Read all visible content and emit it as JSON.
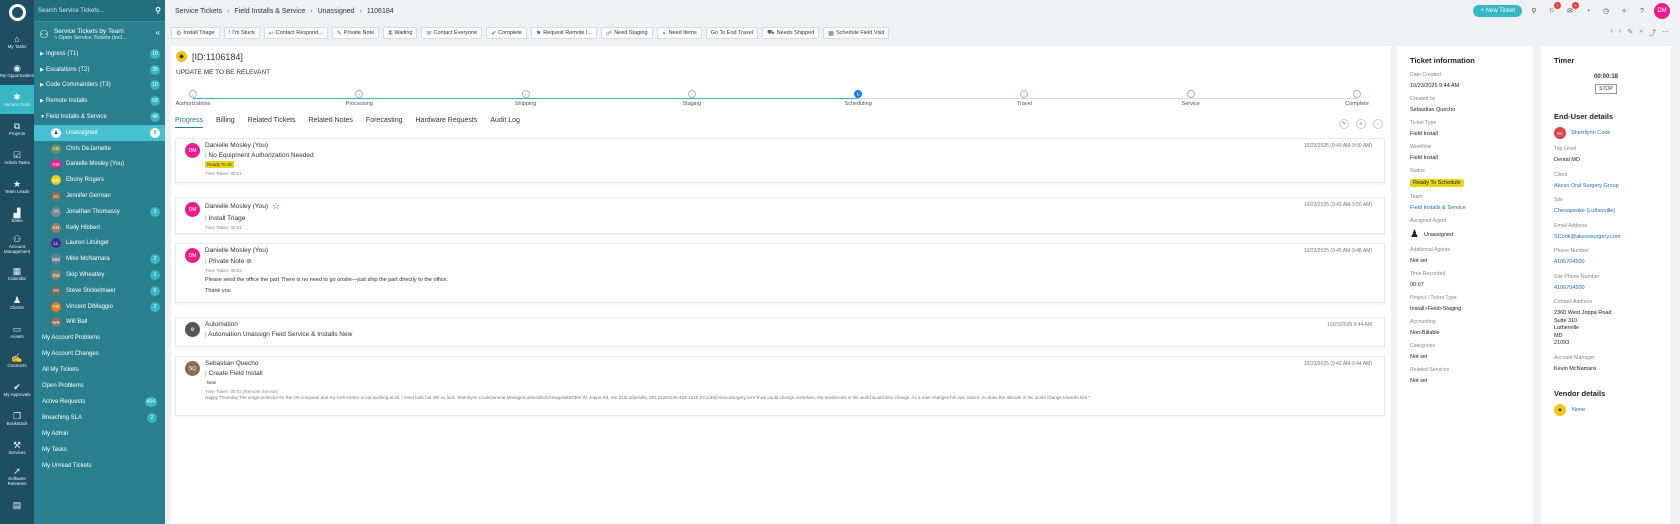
{
  "rail": [
    {
      "label": "My Tasks",
      "icon": "house-icon",
      "glyph": "⌂",
      "active": false
    },
    {
      "label": "My Opportunities",
      "icon": "eye-icon",
      "glyph": "◉",
      "active": false
    },
    {
      "label": "Service Desk",
      "icon": "ticket-icon",
      "glyph": "✱",
      "active": true
    },
    {
      "label": "Projects",
      "icon": "projects-icon",
      "glyph": "⧉",
      "active": false
    },
    {
      "label": "Admin Tasks",
      "icon": "checklist-icon",
      "glyph": "☑",
      "active": false
    },
    {
      "label": "Team Leads",
      "icon": "star-icon",
      "glyph": "★",
      "active": false
    },
    {
      "label": "Sales",
      "icon": "bar-chart-icon",
      "glyph": "▟",
      "active": false
    },
    {
      "label": "Account Management",
      "icon": "people-icon",
      "glyph": "⚇",
      "active": false
    },
    {
      "label": "Calendar",
      "icon": "calendar-icon",
      "glyph": "▦",
      "active": false
    },
    {
      "label": "Clients",
      "icon": "person-icon",
      "glyph": "♟",
      "active": false
    },
    {
      "label": "Assets",
      "icon": "monitor-icon",
      "glyph": "▭",
      "active": false
    },
    {
      "label": "Contracts",
      "icon": "handshake-icon",
      "glyph": "✍",
      "active": false
    },
    {
      "label": "My Approvals",
      "icon": "thumbs-up-icon",
      "glyph": "✔",
      "active": false
    },
    {
      "label": "Bookstack",
      "icon": "book-icon",
      "glyph": "❐",
      "active": false
    },
    {
      "label": "Services",
      "icon": "services-icon",
      "glyph": "⚒",
      "active": false
    },
    {
      "label": "Software Releases",
      "icon": "rocket-icon",
      "glyph": "➚",
      "active": false
    },
    {
      "label": "",
      "icon": "document-icon",
      "glyph": "▤",
      "active": false
    }
  ],
  "sidebar": {
    "search_placeholder": "Search Service Tickets...",
    "header_title": "Service Tickets by Team",
    "header_sub": "Open Service Tickets (incl...",
    "sections": [
      {
        "label": "Ingress (T1)",
        "count": "10",
        "open": false
      },
      {
        "label": "Escalations (T2)",
        "count": "39",
        "open": false
      },
      {
        "label": "Code Commanders (T3)",
        "count": "10",
        "open": false
      },
      {
        "label": "Remote Installs",
        "count": "68",
        "open": false
      },
      {
        "label": "Field Installs & Service",
        "count": "48",
        "open": true
      }
    ],
    "members": [
      {
        "name": "Unassigned",
        "count": "8",
        "initials": "",
        "color": "#ffffff",
        "selected": true
      },
      {
        "name": "Chris DeJarnette",
        "count": "",
        "initials": "CD",
        "color": "#6d8f5a",
        "selected": false
      },
      {
        "name": "Danielle Mosley (You)",
        "count": "",
        "initials": "DM",
        "color": "#e91e8c",
        "selected": false
      },
      {
        "name": "Ebony Rogers",
        "count": "",
        "initials": "ER",
        "color": "#e6d21a",
        "selected": false
      },
      {
        "name": "Jennifer German",
        "count": "",
        "initials": "JG",
        "color": "#8a6d4e",
        "selected": false
      },
      {
        "name": "Jonathan Thomassy",
        "count": "3",
        "initials": "JT",
        "color": "#7a8a9a",
        "selected": false
      },
      {
        "name": "Kelly Hibbert",
        "count": "",
        "initials": "KH",
        "color": "#9c7d6a",
        "selected": false
      },
      {
        "name": "Lauren Litsinger",
        "count": "",
        "initials": "LL",
        "color": "#3f2f8c",
        "selected": false
      },
      {
        "name": "Mike McNamara",
        "count": "2",
        "initials": "MM",
        "color": "#6b7f8f",
        "selected": false
      },
      {
        "name": "Skip Wheatley",
        "count": "1",
        "initials": "SW",
        "color": "#8a7a6a",
        "selected": false
      },
      {
        "name": "Steve Stickelmaier",
        "count": "6",
        "initials": "SS",
        "color": "#7a6a5a",
        "selected": false
      },
      {
        "name": "Vincent DiMaggio",
        "count": "2",
        "initials": "VD",
        "color": "#e57c1a",
        "selected": false
      },
      {
        "name": "Will Ball",
        "count": "",
        "initials": "WB",
        "color": "#8a7060",
        "selected": false
      }
    ],
    "links": [
      {
        "label": "My Account Problems",
        "count": ""
      },
      {
        "label": "My Account Changes",
        "count": ""
      },
      {
        "label": "All My Tickets",
        "count": ""
      },
      {
        "label": "Open Problems",
        "count": ""
      },
      {
        "label": "Active Requests",
        "count": "404"
      },
      {
        "label": "Breaching SLA",
        "count": "2"
      },
      {
        "label": "My Admin",
        "count": ""
      },
      {
        "label": "My Tasks",
        "count": ""
      },
      {
        "label": "My Unread Tickets",
        "count": ""
      }
    ]
  },
  "breadcrumb": [
    "Service Tickets",
    "Field Installs & Service",
    "Unassigned",
    "1106184"
  ],
  "topbar": {
    "new_ticket": "+ New Ticket",
    "user_initials": "DM",
    "badge_a": "2",
    "badge_b": "9"
  },
  "actions": [
    {
      "label": "Install Triage",
      "glyph": "⚙"
    },
    {
      "label": "I'm Stuck",
      "glyph": "!"
    },
    {
      "label": "Contact Respond...",
      "glyph": "↩"
    },
    {
      "label": "Private Note",
      "glyph": "✎"
    },
    {
      "label": "Waiting",
      "glyph": "⧗"
    },
    {
      "label": "Contact Everyone",
      "glyph": "✉"
    },
    {
      "label": "Complete",
      "glyph": "✔"
    },
    {
      "label": "Request Remote I...",
      "glyph": "⚑"
    },
    {
      "label": "Need Staging",
      "glyph": "☍"
    },
    {
      "label": "Need Items",
      "glyph": "⚬"
    },
    {
      "label": "Go To End Travel",
      "glyph": ""
    },
    {
      "label": "Needs Shipped",
      "glyph": "⛟"
    },
    {
      "label": "Schedule Field Visit",
      "glyph": "▦"
    }
  ],
  "ticket": {
    "id": "[ID:1106184]",
    "subject": "UPDATE ME TO BE RELEVANT"
  },
  "stages": [
    "Authorizations",
    "Processing",
    "Shipping",
    "Staging",
    "Scheduling",
    "Travel",
    "Service",
    "Complete"
  ],
  "stages_done": 4,
  "tabs": [
    "Progress",
    "Billing",
    "Related Tickets",
    "Related Notes",
    "Forecasting",
    "Hardware Requests",
    "Audit Log"
  ],
  "events": [
    {
      "author": "Danielle Mosley (You)",
      "initials": "DM",
      "color": "#e91e8c",
      "title": "No Equipment Authorization Needed",
      "chip": "Ready To Sc",
      "chip_color": "#e8d51a",
      "taken": "Time Taken: 00:01",
      "time": "10/23/2025 (9:49 AM-9:50 AM)",
      "lines": [],
      "long": "",
      "star": false,
      "note": false
    },
    {
      "author": "Danielle Mosley (You)",
      "initials": "DM",
      "color": "#e91e8c",
      "title": "Install Triage",
      "chip": "",
      "chip_color": "",
      "taken": "Time Taken: 00:01",
      "time": "10/23/2025 (9:49 AM-9:50 AM)",
      "lines": [],
      "long": "",
      "star": true,
      "note": false
    },
    {
      "author": "Danielle Mosley (You)",
      "initials": "DM",
      "color": "#e91e8c",
      "title": "Private Note",
      "chip": "",
      "chip_color": "",
      "taken": "Time Taken: 00:03",
      "time": "10/23/2025 (9:45 AM-9:48 AM)",
      "lines": [
        "Please send the office the part There is no need to go onsite—just ship the part directly to the office.",
        "Thank you"
      ],
      "long": "",
      "star": false,
      "note": true
    },
    {
      "author": "Automation",
      "initials": "",
      "color": "#555555",
      "title": "Automation Unassign Field Service & Installs New",
      "chip": "",
      "chip_color": "",
      "taken": "",
      "time": "10/23/2025 9:44 AM",
      "lines": [],
      "long": "",
      "star": false,
      "note": false
    },
    {
      "author": "Sebastian Quecho",
      "initials": "SQ",
      "color": "#8a6d4e",
      "title": "Create Field Install",
      "chip": "New",
      "chip_color": "#ffffff",
      "taken": "Time Taken: 00:02 (Remote Service)",
      "time": "10/23/2025 (9:42 AM-9:44 AM)",
      "lines": [],
      "long": "Happy Thursday,The surge protector for the OA computer and my Cell Center is not working at all. I reset both but still no luck. Sherrilynn CookGeneral ManagerLutherville/Chesapeake2360 W. Joppa Rd, Ste 310Lutherville, MD 21093240-429-4219 SCook@AkesoSurgery.com\"If we could change ourselves, the tendencies in the world would also change. As a man changes his own nature, so does the attitude of the world change towards him.\"",
      "star": false,
      "note": false
    }
  ],
  "info": {
    "title": "Ticket information",
    "fields": [
      {
        "label": "Date Created",
        "value": "10/23/2025 9:44 AM",
        "type": "text"
      },
      {
        "label": "Created by",
        "value": "Sebastian Quecho",
        "type": "text"
      },
      {
        "label": "Ticket Type",
        "value": "Field Install",
        "type": "text"
      },
      {
        "label": "Workflow",
        "value": "Field Install",
        "type": "text"
      },
      {
        "label": "Status",
        "value": "Ready To Schedule",
        "type": "chip"
      },
      {
        "label": "Team",
        "value": "Field Installs & Service",
        "type": "link"
      },
      {
        "label": "Assigned Agent",
        "value": "Unassigned",
        "type": "agent"
      },
      {
        "label": "Additional Agents",
        "value": "Not set",
        "type": "text"
      },
      {
        "label": "Time Recorded",
        "value": "00:07",
        "type": "text"
      },
      {
        "label": "Project / Ticket Type",
        "value": "Install>Field>Staging",
        "type": "text"
      },
      {
        "label": "Accounting",
        "value": "Non-Billable",
        "type": "text"
      },
      {
        "label": "Categories",
        "value": "Not set",
        "type": "text"
      },
      {
        "label": "Related Services",
        "value": "Not set",
        "type": "text"
      }
    ]
  },
  "timer": {
    "title": "Timer",
    "value": "00:00:18",
    "stop": "STOP"
  },
  "enduser": {
    "title": "End-User details",
    "name": "Sherrilynn Cook",
    "initials": "SC",
    "fields": [
      {
        "label": "Top Level",
        "value": "Dental MD",
        "type": "text"
      },
      {
        "label": "Client",
        "value": "Akeso Oral Surgery Group",
        "type": "link"
      },
      {
        "label": "Site",
        "value": "Chesapeake (Lutherville)",
        "type": "link"
      },
      {
        "label": "Email Address",
        "value": "SCook@akesosurgery.com",
        "type": "link"
      },
      {
        "label": "Phone Number",
        "value": "4106704500",
        "type": "link"
      },
      {
        "label": "Site Phone Number",
        "value": "4106704500",
        "type": "link"
      },
      {
        "label": "Contact Address",
        "value": "2360 West Joppa Road\nSuite 310\nLutherville\nMD\n21093",
        "type": "text"
      },
      {
        "label": "Account Manager",
        "value": "Kevin McNamara",
        "type": "text"
      }
    ]
  },
  "vendor": {
    "title": "Vendor details",
    "value": "None"
  }
}
